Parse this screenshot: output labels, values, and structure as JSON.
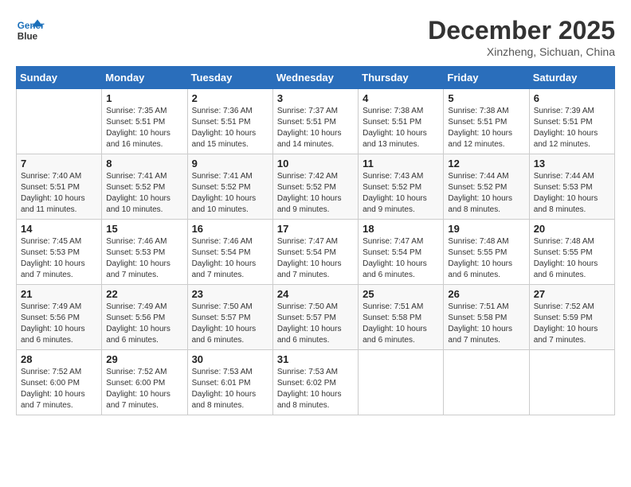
{
  "header": {
    "logo_line1": "General",
    "logo_line2": "Blue",
    "month": "December 2025",
    "location": "Xinzheng, Sichuan, China"
  },
  "weekdays": [
    "Sunday",
    "Monday",
    "Tuesday",
    "Wednesday",
    "Thursday",
    "Friday",
    "Saturday"
  ],
  "weeks": [
    [
      {
        "day": "",
        "info": ""
      },
      {
        "day": "1",
        "info": "Sunrise: 7:35 AM\nSunset: 5:51 PM\nDaylight: 10 hours\nand 16 minutes."
      },
      {
        "day": "2",
        "info": "Sunrise: 7:36 AM\nSunset: 5:51 PM\nDaylight: 10 hours\nand 15 minutes."
      },
      {
        "day": "3",
        "info": "Sunrise: 7:37 AM\nSunset: 5:51 PM\nDaylight: 10 hours\nand 14 minutes."
      },
      {
        "day": "4",
        "info": "Sunrise: 7:38 AM\nSunset: 5:51 PM\nDaylight: 10 hours\nand 13 minutes."
      },
      {
        "day": "5",
        "info": "Sunrise: 7:38 AM\nSunset: 5:51 PM\nDaylight: 10 hours\nand 12 minutes."
      },
      {
        "day": "6",
        "info": "Sunrise: 7:39 AM\nSunset: 5:51 PM\nDaylight: 10 hours\nand 12 minutes."
      }
    ],
    [
      {
        "day": "7",
        "info": "Sunrise: 7:40 AM\nSunset: 5:51 PM\nDaylight: 10 hours\nand 11 minutes."
      },
      {
        "day": "8",
        "info": "Sunrise: 7:41 AM\nSunset: 5:52 PM\nDaylight: 10 hours\nand 10 minutes."
      },
      {
        "day": "9",
        "info": "Sunrise: 7:41 AM\nSunset: 5:52 PM\nDaylight: 10 hours\nand 10 minutes."
      },
      {
        "day": "10",
        "info": "Sunrise: 7:42 AM\nSunset: 5:52 PM\nDaylight: 10 hours\nand 9 minutes."
      },
      {
        "day": "11",
        "info": "Sunrise: 7:43 AM\nSunset: 5:52 PM\nDaylight: 10 hours\nand 9 minutes."
      },
      {
        "day": "12",
        "info": "Sunrise: 7:44 AM\nSunset: 5:52 PM\nDaylight: 10 hours\nand 8 minutes."
      },
      {
        "day": "13",
        "info": "Sunrise: 7:44 AM\nSunset: 5:53 PM\nDaylight: 10 hours\nand 8 minutes."
      }
    ],
    [
      {
        "day": "14",
        "info": "Sunrise: 7:45 AM\nSunset: 5:53 PM\nDaylight: 10 hours\nand 7 minutes."
      },
      {
        "day": "15",
        "info": "Sunrise: 7:46 AM\nSunset: 5:53 PM\nDaylight: 10 hours\nand 7 minutes."
      },
      {
        "day": "16",
        "info": "Sunrise: 7:46 AM\nSunset: 5:54 PM\nDaylight: 10 hours\nand 7 minutes."
      },
      {
        "day": "17",
        "info": "Sunrise: 7:47 AM\nSunset: 5:54 PM\nDaylight: 10 hours\nand 7 minutes."
      },
      {
        "day": "18",
        "info": "Sunrise: 7:47 AM\nSunset: 5:54 PM\nDaylight: 10 hours\nand 6 minutes."
      },
      {
        "day": "19",
        "info": "Sunrise: 7:48 AM\nSunset: 5:55 PM\nDaylight: 10 hours\nand 6 minutes."
      },
      {
        "day": "20",
        "info": "Sunrise: 7:48 AM\nSunset: 5:55 PM\nDaylight: 10 hours\nand 6 minutes."
      }
    ],
    [
      {
        "day": "21",
        "info": "Sunrise: 7:49 AM\nSunset: 5:56 PM\nDaylight: 10 hours\nand 6 minutes."
      },
      {
        "day": "22",
        "info": "Sunrise: 7:49 AM\nSunset: 5:56 PM\nDaylight: 10 hours\nand 6 minutes."
      },
      {
        "day": "23",
        "info": "Sunrise: 7:50 AM\nSunset: 5:57 PM\nDaylight: 10 hours\nand 6 minutes."
      },
      {
        "day": "24",
        "info": "Sunrise: 7:50 AM\nSunset: 5:57 PM\nDaylight: 10 hours\nand 6 minutes."
      },
      {
        "day": "25",
        "info": "Sunrise: 7:51 AM\nSunset: 5:58 PM\nDaylight: 10 hours\nand 6 minutes."
      },
      {
        "day": "26",
        "info": "Sunrise: 7:51 AM\nSunset: 5:58 PM\nDaylight: 10 hours\nand 7 minutes."
      },
      {
        "day": "27",
        "info": "Sunrise: 7:52 AM\nSunset: 5:59 PM\nDaylight: 10 hours\nand 7 minutes."
      }
    ],
    [
      {
        "day": "28",
        "info": "Sunrise: 7:52 AM\nSunset: 6:00 PM\nDaylight: 10 hours\nand 7 minutes."
      },
      {
        "day": "29",
        "info": "Sunrise: 7:52 AM\nSunset: 6:00 PM\nDaylight: 10 hours\nand 7 minutes."
      },
      {
        "day": "30",
        "info": "Sunrise: 7:53 AM\nSunset: 6:01 PM\nDaylight: 10 hours\nand 8 minutes."
      },
      {
        "day": "31",
        "info": "Sunrise: 7:53 AM\nSunset: 6:02 PM\nDaylight: 10 hours\nand 8 minutes."
      },
      {
        "day": "",
        "info": ""
      },
      {
        "day": "",
        "info": ""
      },
      {
        "day": "",
        "info": ""
      }
    ]
  ]
}
